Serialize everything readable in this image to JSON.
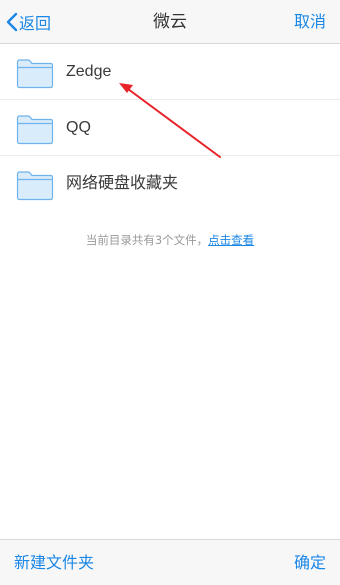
{
  "nav": {
    "back_label": "返回",
    "title": "微云",
    "cancel_label": "取消"
  },
  "folders": [
    {
      "name": "Zedge",
      "icon": "folder-icon"
    },
    {
      "name": "QQ",
      "icon": "folder-icon"
    },
    {
      "name": "网络硬盘收藏夹",
      "icon": "folder-icon"
    }
  ],
  "info": {
    "text": "当前目录共有3个文件，",
    "link": "点击查看"
  },
  "toolbar": {
    "new_folder_label": "新建文件夹",
    "confirm_label": "确定"
  },
  "colors": {
    "accent": "#1a87e6",
    "annotation": "#e8232a",
    "folder_fill": "#d9ecfb",
    "folder_stroke": "#6fb3ea"
  }
}
